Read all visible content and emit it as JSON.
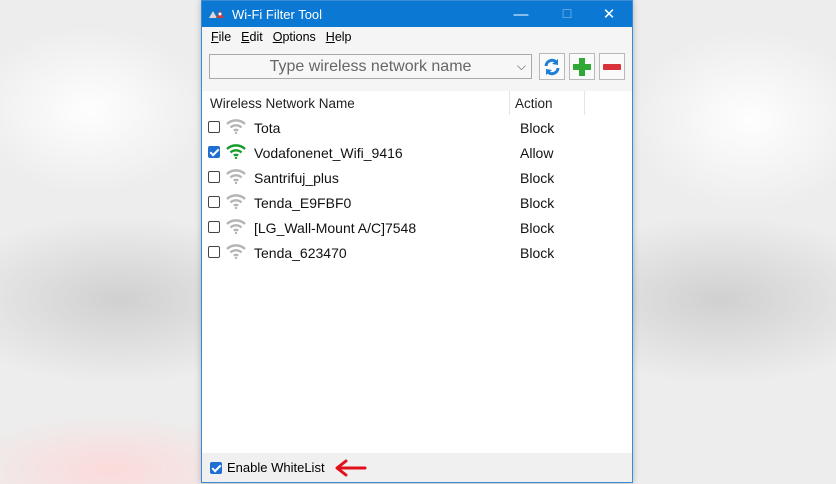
{
  "window": {
    "title": "Wi-Fi Filter Tool",
    "minimize": "—",
    "maximize": "☐",
    "close": "✕"
  },
  "menu": [
    {
      "label": "File",
      "key": "F",
      "rest": "ile"
    },
    {
      "label": "Edit",
      "key": "E",
      "rest": "dit"
    },
    {
      "label": "Options",
      "key": "O",
      "rest": "ptions"
    },
    {
      "label": "Help",
      "key": "H",
      "rest": "elp"
    }
  ],
  "toolbar": {
    "network_placeholder": "Type wireless network name",
    "network_value": "",
    "refresh_icon": "refresh-icon",
    "add_icon": "plus-icon",
    "remove_icon": "minus-icon"
  },
  "list": {
    "columns": [
      "Wireless Network Name",
      "Action"
    ],
    "rows": [
      {
        "checked": false,
        "name": "Tota",
        "action": "Block",
        "signal": "gray"
      },
      {
        "checked": true,
        "name": "Vodafonenet_Wifi_9416",
        "action": "Allow",
        "signal": "green"
      },
      {
        "checked": false,
        "name": "Santrifuj_plus",
        "action": "Block",
        "signal": "gray"
      },
      {
        "checked": false,
        "name": "Tenda_E9FBF0",
        "action": "Block",
        "signal": "gray"
      },
      {
        "checked": false,
        "name": "[LG_Wall-Mount A/C]7548",
        "action": "Block",
        "signal": "gray"
      },
      {
        "checked": false,
        "name": "Tenda_623470",
        "action": "Block",
        "signal": "gray"
      }
    ]
  },
  "status": {
    "whitelist_checked": true,
    "whitelist_label": "Enable WhiteList"
  },
  "colors": {
    "titlebar": "#0b78d4",
    "accent": "#1e6fd0",
    "signal_green": "#1a9c2e",
    "signal_gray": "#b5b5b5",
    "arrow_red": "#e0101a"
  }
}
